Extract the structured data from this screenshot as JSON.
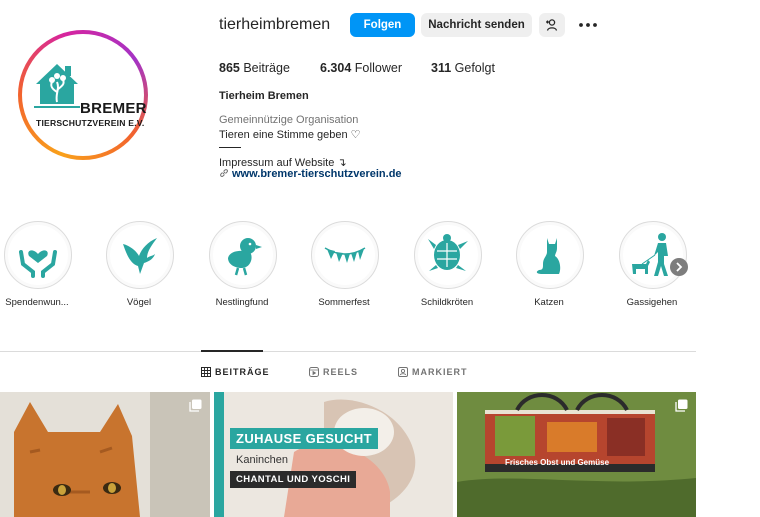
{
  "profile": {
    "username": "tierheimbremen",
    "follow_label": "Folgen",
    "message_label": "Nachricht senden",
    "logo_line1": "BREMER",
    "logo_line2": "TIERSCHUTZVEREIN E.V."
  },
  "stats": {
    "posts_count": "865",
    "posts_label": "Beiträge",
    "followers_count": "6.304",
    "followers_label": "Follower",
    "following_count": "311",
    "following_label": "Gefolgt"
  },
  "bio": {
    "name": "Tierheim Bremen",
    "category": "Gemeinnützige Organisation",
    "line1": "Tieren eine Stimme geben ♡",
    "line2": "Impressum auf Website ↴",
    "link": "www.bremer-tierschutzverein.de"
  },
  "highlights": [
    {
      "label": "Spendenwun..."
    },
    {
      "label": "Vögel"
    },
    {
      "label": "Nestlingfund"
    },
    {
      "label": "Sommerfest"
    },
    {
      "label": "Schildkröten"
    },
    {
      "label": "Katzen"
    },
    {
      "label": "Gassigehen"
    }
  ],
  "tabs": [
    {
      "label": "BEITRÄGE"
    },
    {
      "label": "REELS"
    },
    {
      "label": "MARKIERT"
    }
  ],
  "posts": [
    {
      "caption": ""
    },
    {
      "headline": "ZUHAUSE GESUCHT",
      "sub": "Kaninchen",
      "names": "CHANTAL UND YOSCHI"
    },
    {
      "bag_text": "Frisches Obst und Gemüse"
    }
  ],
  "colors": {
    "accent": "#0095f6",
    "teal": "#2aa6a0",
    "link": "#00376b"
  }
}
